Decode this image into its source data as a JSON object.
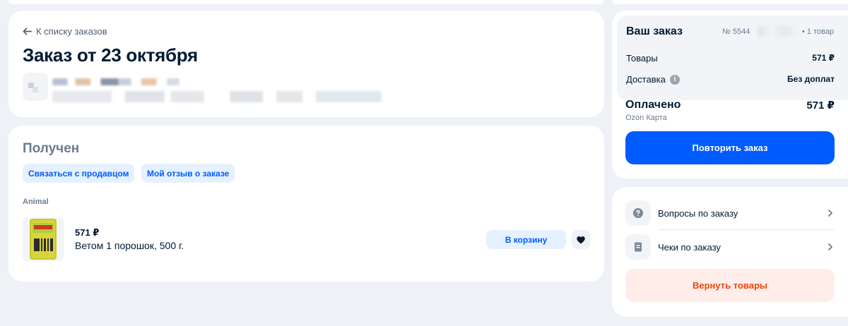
{
  "header": {
    "back_label": "К списку заказов",
    "title": "Заказ от 23 октября"
  },
  "status": {
    "title": "Получен",
    "contact_seller": "Связаться с продавцом",
    "my_review": "Мой отзыв о заказе",
    "seller": "Animal",
    "item": {
      "price": "571 ₽",
      "name": "Ветом 1 порошок, 500 г.",
      "cart_button": "В корзину"
    }
  },
  "summary": {
    "title": "Ваш заказ",
    "order_prefix": "№ 5544",
    "items_count": "• 1 товар",
    "goods_label": "Товары",
    "goods_value": "571 ₽",
    "delivery_label": "Доставка",
    "delivery_value": "Без доплат",
    "paid_label": "Оплачено",
    "paid_value": "571 ₽",
    "payment_method": "Ozon Карта",
    "repeat_button": "Повторить заказ"
  },
  "links": {
    "questions": "Вопросы по заказу",
    "receipts": "Чеки по заказу",
    "return_button": "Вернуть товары"
  },
  "colors": {
    "accent": "#005bff",
    "accent_light": "#e5f1ff",
    "return_text": "#f1440e",
    "return_bg": "#ffede9",
    "background": "#eef1f6"
  }
}
